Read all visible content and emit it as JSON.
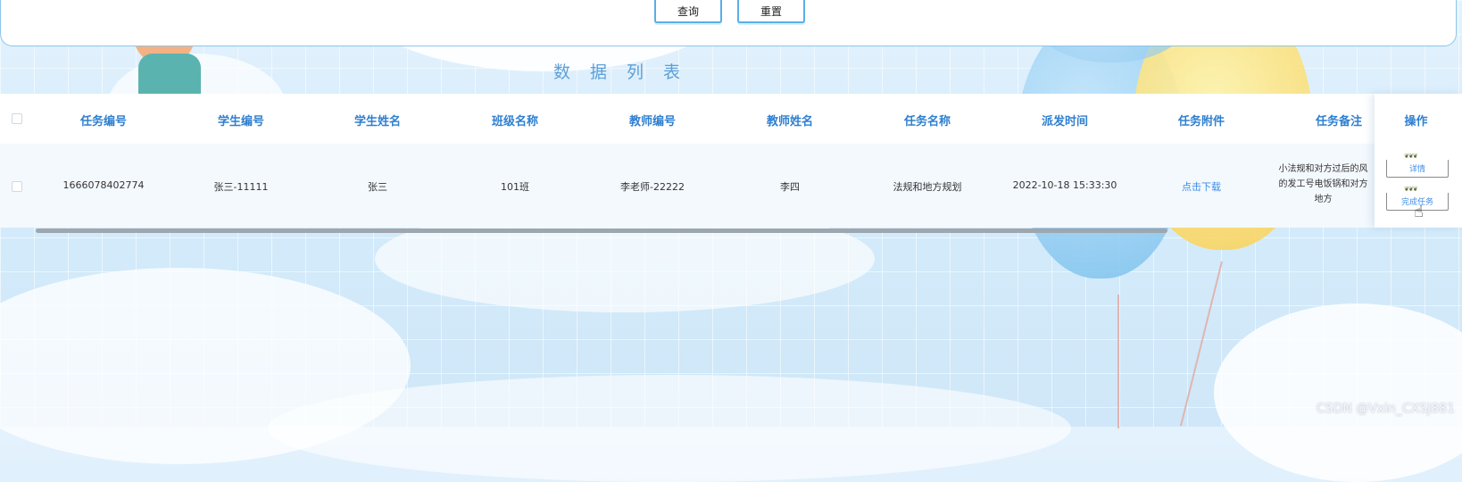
{
  "search": {
    "query_label": "查询",
    "reset_label": "重置"
  },
  "list_title": "数据列表",
  "table": {
    "columns": [
      "任务编号",
      "学生编号",
      "学生姓名",
      "班级名称",
      "教师编号",
      "教师姓名",
      "任务名称",
      "派发时间",
      "任务附件",
      "任务备注",
      "操作"
    ],
    "rows": [
      {
        "task_no": "1666078402774",
        "student_no": "张三-11111",
        "student_name": "张三",
        "class_name": "101班",
        "teacher_no": "李老师-22222",
        "teacher_name": "李四",
        "task_name": "法规和地方规划",
        "dispatch_time": "2022-10-18 15:33:30",
        "attachment": "点击下载",
        "remark_lines": [
          "小法规和对方过后的风",
          "的发工号电饭锅和对方",
          "地方"
        ],
        "actions": {
          "detail": "详情",
          "complete": "完成任务"
        }
      }
    ]
  },
  "watermark": "CSDN @Vxin_CXSJ881",
  "colors": {
    "header_text": "#2f7fd0",
    "link": "#3d8de6",
    "panel_border": "#8cc6ec",
    "background": "#d4ebfa"
  }
}
